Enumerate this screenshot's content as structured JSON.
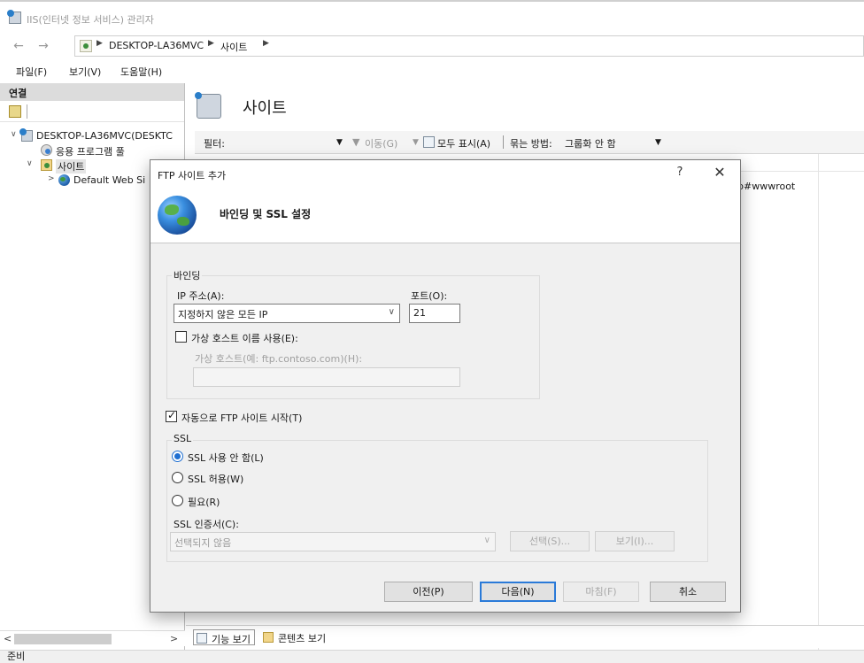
{
  "window": {
    "title": "IIS(인터넷 정보 서비스) 관리자"
  },
  "address": {
    "crumbs": [
      "DESKTOP-LA36MVC",
      "사이트"
    ]
  },
  "menu": [
    "파일(F)",
    "보기(V)",
    "도움말(H)"
  ],
  "connections": {
    "header": "연결",
    "tree": {
      "server": "DESKTOP-LA36MVC(DESKTC",
      "app_pools": "응용 프로그램 풀",
      "sites": "사이트",
      "default_site": "Default Web Si"
    }
  },
  "main": {
    "title": "사이트",
    "filter_label": "필터:",
    "go_label": "이동(G)",
    "show_all_label": "모두 표시(A)",
    "group_by_label": "묶는 방법:",
    "group_by_value": "그룹화 안 함",
    "bg_path_text": "b#wwwroot",
    "tabs": {
      "features": "기능 보기",
      "content": "콘텐츠 보기"
    }
  },
  "status": {
    "text": "준비"
  },
  "dialog": {
    "title": "FTP 사이트 추가",
    "help": "?",
    "close": "✕",
    "heading": "바인딩 및 SSL 설정",
    "binding": {
      "group_label": "바인딩",
      "ip_label": "IP 주소(A):",
      "ip_value": "지정하지 않은 모든 IP",
      "port_label": "포트(O):",
      "port_value": "21",
      "vhost_checkbox_label": "가상 호스트 이름 사용(E):",
      "vhost_checked": false,
      "vhost_field_label": "가상 호스트(예: ftp.contoso.com)(H):",
      "vhost_value": ""
    },
    "auto_start_label": "자동으로 FTP 사이트 시작(T)",
    "auto_start_checked": true,
    "ssl": {
      "group_label": "SSL",
      "options": [
        "SSL 사용 안 함(L)",
        "SSL 허용(W)",
        "필요(R)"
      ],
      "selected_index": 0,
      "cert_label": "SSL 인증서(C):",
      "cert_value": "선택되지 않음",
      "select_button": "선택(S)...",
      "view_button": "보기(I)..."
    },
    "buttons": {
      "prev": "이전(P)",
      "next": "다음(N)",
      "finish": "마침(F)",
      "cancel": "취소"
    }
  }
}
